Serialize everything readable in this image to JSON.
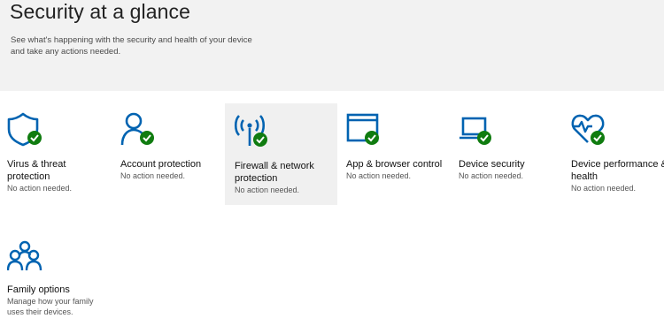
{
  "header": {
    "title": "Security at a glance",
    "subtitle_line1": "See what's happening with the security and health of your device",
    "subtitle_line2": "and take any actions needed."
  },
  "tiles": [
    {
      "name_line1": "Virus & threat",
      "name_line2": "protection",
      "status": "No action needed.",
      "icon": "shield-icon"
    },
    {
      "name_line1": "Account protection",
      "name_line2": "",
      "status": "No action needed.",
      "icon": "person-icon"
    },
    {
      "name_line1": "Firewall & network",
      "name_line2": "protection",
      "status": "No action needed.",
      "icon": "antenna-icon"
    },
    {
      "name_line1": "App & browser control",
      "name_line2": "",
      "status": "No action needed.",
      "icon": "browser-window-icon"
    },
    {
      "name_line1": "Device security",
      "name_line2": "",
      "status": "No action needed.",
      "icon": "laptop-icon"
    },
    {
      "name_line1": "Device performance &",
      "name_line2": "health",
      "status": "No action needed.",
      "icon": "heart-pulse-icon"
    },
    {
      "name_line1": "Family options",
      "name_line2": "",
      "status_line1": "Manage how your family",
      "status_line2": "uses their devices.",
      "icon": "family-icon"
    }
  ],
  "colors": {
    "icon_blue": "#0063b1",
    "check_green": "#107c10",
    "header_bg": "#f2f2f2",
    "selected_bg": "#f0f0f0"
  }
}
